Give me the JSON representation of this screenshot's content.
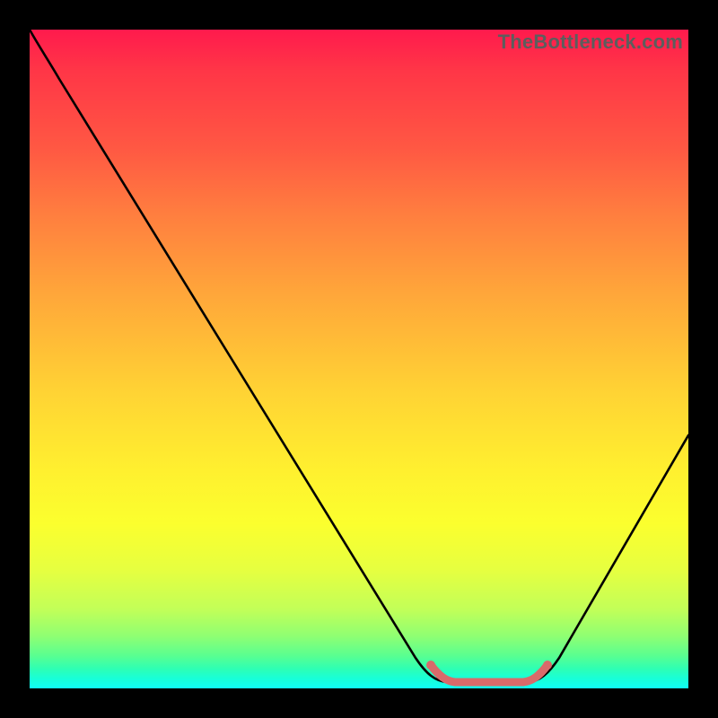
{
  "watermark": "TheBottleneck.com",
  "chart_data": {
    "type": "line",
    "title": "",
    "xlabel": "",
    "ylabel": "",
    "xlim": [
      0,
      100
    ],
    "ylim": [
      0,
      100
    ],
    "series": [
      {
        "name": "bottleneck-curve",
        "color": "#000000",
        "x": [
          0,
          4,
          8,
          12,
          16,
          20,
          24,
          28,
          32,
          36,
          40,
          44,
          48,
          52,
          56,
          60,
          62,
          64,
          66,
          68,
          70,
          72,
          74,
          76,
          78,
          82,
          86,
          90,
          94,
          98,
          100
        ],
        "values": [
          100,
          97,
          93,
          88,
          83,
          77,
          71,
          65,
          59,
          53,
          47,
          41,
          35,
          29,
          23,
          16,
          12,
          8,
          4,
          2,
          1,
          1,
          1,
          1,
          2,
          6,
          12,
          19,
          26,
          34,
          38
        ]
      },
      {
        "name": "optimal-band",
        "color": "#e06666",
        "x": [
          62,
          64,
          66,
          68,
          70,
          72,
          74,
          76,
          78
        ],
        "values": [
          4,
          2,
          1,
          0.8,
          0.8,
          0.8,
          0.8,
          1,
          2
        ]
      }
    ],
    "annotations": []
  }
}
